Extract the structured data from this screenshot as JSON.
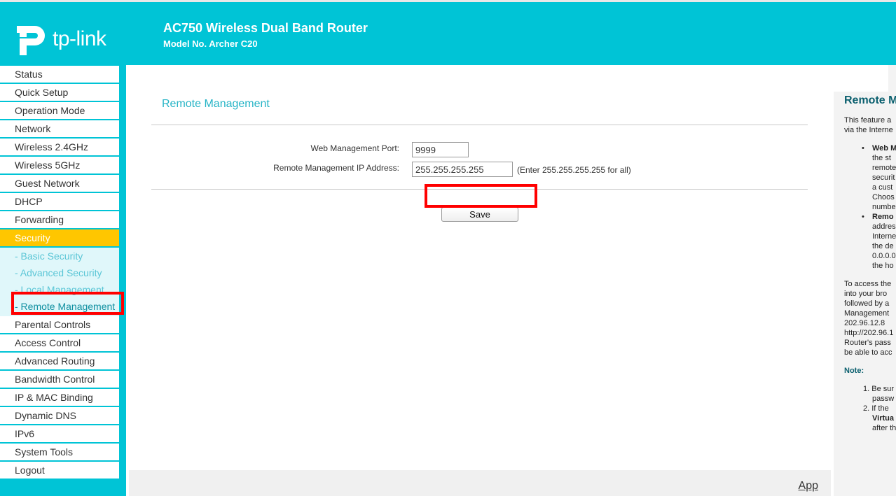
{
  "brand": {
    "logo_text": "tp-link",
    "product_title": "AC750 Wireless Dual Band Router",
    "model": "Model No. Archer C20",
    "color": "#00c4d6"
  },
  "nav": {
    "items_top": [
      "Status",
      "Quick Setup",
      "Operation Mode",
      "Network",
      "Wireless 2.4GHz",
      "Wireless 5GHz",
      "Guest Network",
      "DHCP",
      "Forwarding"
    ],
    "active": "Security",
    "sub_items": [
      "- Basic Security",
      "- Advanced Security",
      "- Local Management",
      "- Remote Management"
    ],
    "items_bottom": [
      "Parental Controls",
      "Access Control",
      "Advanced Routing",
      "Bandwidth Control",
      "IP & MAC Binding",
      "Dynamic DNS",
      "IPv6",
      "System Tools",
      "Logout"
    ],
    "active_color": "#ffc600"
  },
  "main": {
    "title": "Remote Management",
    "port_label": "Web Management Port:",
    "port_value": "9999",
    "ip_label": "Remote Management IP Address:",
    "ip_value": "255.255.255.255",
    "ip_hint": "(Enter 255.255.255.255 for all)",
    "save_label": "Save",
    "app_link": "App"
  },
  "help": {
    "title": "Remote M",
    "intro": [
      "This feature a",
      "via the Interne"
    ],
    "bullet1": [
      "Web M",
      "the st",
      "remote",
      "securit",
      "a cust",
      "Choos",
      "numbe"
    ],
    "bullet2": [
      "Remo",
      "addres",
      "Interne",
      "the de",
      "0.0.0.0",
      "the ho"
    ],
    "access": [
      "To access the",
      "into your bro",
      "followed by a",
      "Management",
      "202.96.12.8",
      "http://202.96.1",
      "Router's pass",
      "be able to acc"
    ],
    "note_label": "Note:",
    "note1": [
      "1. Be sur",
      "passw"
    ],
    "note2": [
      "2. If the",
      "Virtua",
      "after th"
    ]
  }
}
